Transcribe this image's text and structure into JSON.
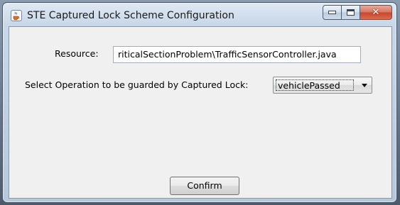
{
  "window": {
    "title": "STE Captured Lock Scheme Configuration",
    "icon": "java-cup-icon",
    "caption_buttons": [
      "minimize-icon",
      "maximize-icon",
      "close-icon"
    ]
  },
  "form": {
    "resource_label": "Resource:",
    "resource_value": "riticalSectionProblem\\TrafficSensorController.java",
    "operation_label": "Select Operation to be guarded by Captured Lock:",
    "operation_selected": "vehiclePassed"
  },
  "buttons": {
    "confirm_label": "Confirm"
  },
  "colors": {
    "close_button": "#c8452a",
    "client_bg": "#f0f0f0"
  }
}
